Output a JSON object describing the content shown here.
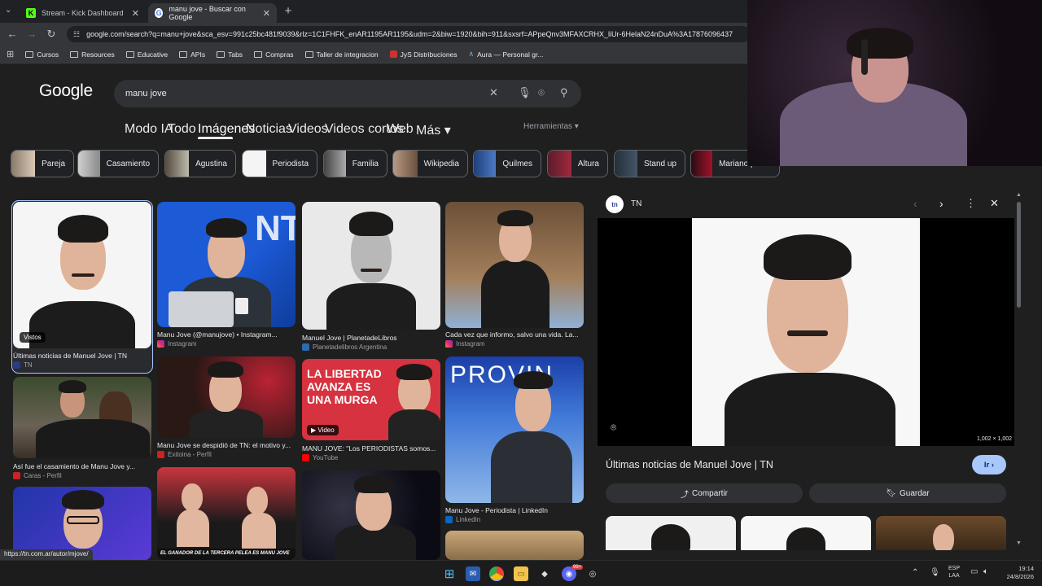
{
  "browser": {
    "tabs": [
      {
        "title": "Stream - Kick Dashboard",
        "active": false
      },
      {
        "title": "manu jove - Buscar con Google",
        "active": true
      }
    ],
    "url": "google.com/search?q=manu+jove&sca_esv=991c25bc481f9039&rlz=1C1FHFK_enAR1195AR1195&udm=2&biw=1920&bih=911&sxsrf=APpeQnv3MFAXCRHX_liUr-6HelaN24nDuA%3A17876096437",
    "bookmarks": [
      "Cursos",
      "Resources",
      "Educative",
      "APIs",
      "Tabs",
      "Compras",
      "Taller de integracion",
      "JyS Distribuciones",
      "Aura — Personal gr..."
    ],
    "status_url": "https://tn.com.ar/autor/mjove/"
  },
  "google": {
    "logo": "Google",
    "query": "manu jove",
    "nav_tabs": [
      "Modo IA",
      "Todo",
      "Imágenes",
      "Noticias",
      "Videos",
      "Videos cortos",
      "Web",
      "Más"
    ],
    "more_arrow": "▾",
    "tools": "Herramientas ▾",
    "chips": [
      "Pareja",
      "Casamiento",
      "Agustina",
      "Periodista",
      "Familia",
      "Wikipedia",
      "Quilmes",
      "Altura",
      "Stand up",
      "Mariano perez"
    ]
  },
  "results": [
    {
      "caption": "Últimas noticias de Manuel Jove | TN",
      "source": "TN",
      "badge": "Vistos"
    },
    {
      "caption": "Manu Jove (@manujove) • Instagram...",
      "source": "Instagram"
    },
    {
      "caption": "Manuel Jove | PlanetadeLibros",
      "source": "Planetadelibros Argentina"
    },
    {
      "caption": "Cada vez que informo, salvo una vida. La...",
      "source": "Instagram"
    },
    {
      "caption": "Así fue el casamiento de Manu Jove y...",
      "source": "Caras - Perfil"
    },
    {
      "caption": "Manu Jove se despidió de TN: el motivo y...",
      "source": "Exitoina - Perfil"
    },
    {
      "caption": "MANU JOVE: \"Los PERIODISTAS somos...",
      "source": "YouTube",
      "badge": "Video",
      "overlay": "LA LIBERTAD AVANZA ES UNA MURGA"
    },
    {
      "caption": "Manu Jove - Periodista | LinkedIn",
      "source": "LinkedIn",
      "overlay": "PROVIN"
    },
    {
      "overlay": "EL GANADOR DE LA TERCERA PELEA ES MANU JOVE"
    }
  ],
  "preview": {
    "source": "TN",
    "title": "Últimas noticias de Manuel Jove | TN",
    "dimensions": "1,002 × 1,002",
    "visit": "Ir",
    "share": "Compartir",
    "save": "Guardar"
  },
  "taskbar": {
    "lang": "ESP",
    "layout": "LAA",
    "time": "19:14",
    "date": "24/8/2026",
    "badge": "99+"
  },
  "colors": {
    "accent": "#a8c7fa",
    "chip_border": "#5f6368"
  }
}
